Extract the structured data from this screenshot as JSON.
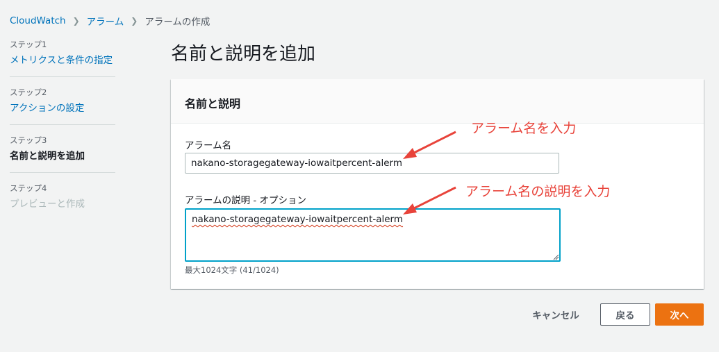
{
  "breadcrumb": {
    "items": [
      "CloudWatch",
      "アラーム"
    ],
    "current": "アラームの作成"
  },
  "steps": [
    {
      "num": "ステップ1",
      "title": "メトリクスと条件の指定",
      "state": "link"
    },
    {
      "num": "ステップ2",
      "title": "アクションの設定",
      "state": "link"
    },
    {
      "num": "ステップ3",
      "title": "名前と説明を追加",
      "state": "active"
    },
    {
      "num": "ステップ4",
      "title": "プレビューと作成",
      "state": "disabled"
    }
  ],
  "page_title": "名前と説明を追加",
  "panel": {
    "title": "名前と説明",
    "name_label": "アラーム名",
    "name_value": "nakano-storagegateway-iowaitpercent-alerm",
    "desc_label": "アラームの説明 - オプション",
    "desc_value": "nakano-storagegateway-iowaitpercent-alerm",
    "desc_hint": "最大1024文字 (41/1024)"
  },
  "annotations": {
    "name_note": "アラーム名を入力",
    "desc_note": "アラーム名の説明を入力",
    "color": "#e8433a"
  },
  "buttons": {
    "cancel": "キャンセル",
    "back": "戻る",
    "next": "次へ"
  },
  "colors": {
    "link": "#0073bb",
    "primary": "#ec7211",
    "focus": "#00a1c9"
  }
}
